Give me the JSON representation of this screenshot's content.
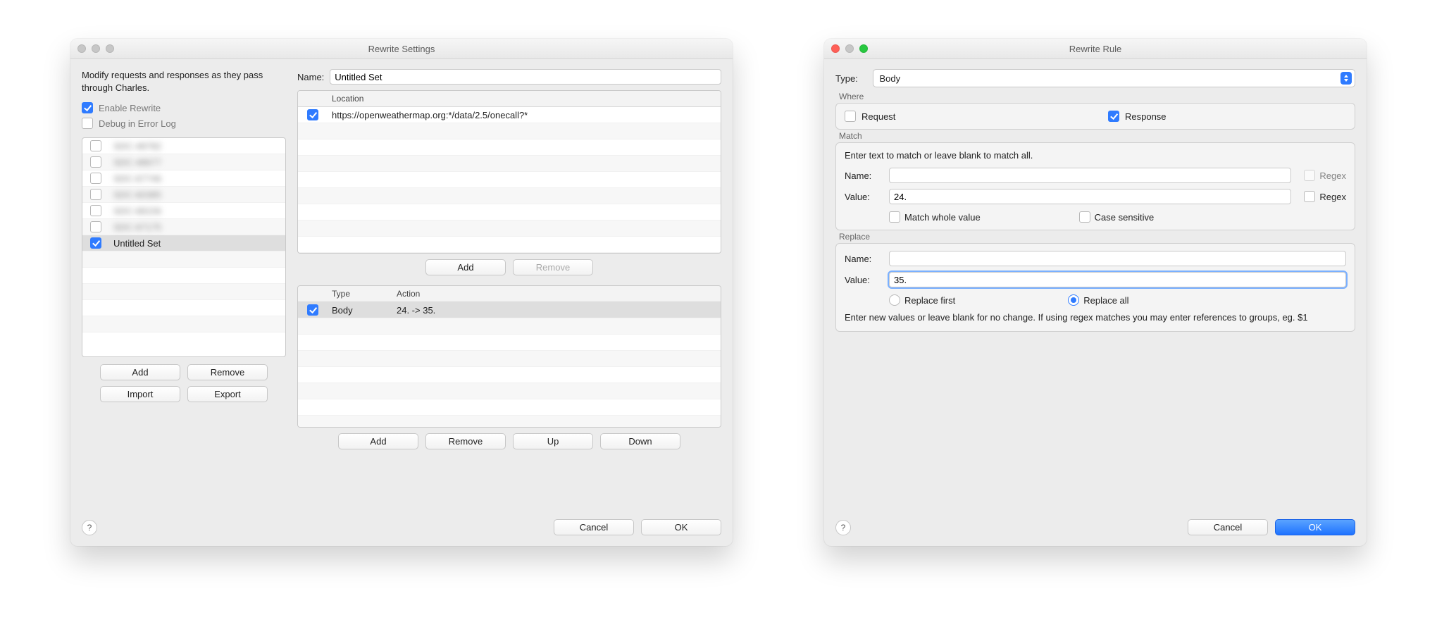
{
  "left": {
    "title": "Rewrite Settings",
    "description": "Modify requests and responses as they pass through Charles.",
    "enable_label": "Enable Rewrite",
    "enable_checked": true,
    "debug_label": "Debug in Error Log",
    "debug_checked": false,
    "sets": {
      "items": [
        {
          "checked": false,
          "label": "SDC-48782",
          "blur": true
        },
        {
          "checked": false,
          "label": "SDC-48677",
          "blur": true
        },
        {
          "checked": false,
          "label": "SDC-67746",
          "blur": true
        },
        {
          "checked": false,
          "label": "SDC-60385",
          "blur": true
        },
        {
          "checked": false,
          "label": "SDC-68156",
          "blur": true
        },
        {
          "checked": false,
          "label": "SDC-67175",
          "blur": true
        },
        {
          "checked": true,
          "label": "Untitled Set",
          "blur": false,
          "selected": true
        }
      ],
      "buttons": {
        "add": "Add",
        "remove": "Remove",
        "import": "Import",
        "export": "Export"
      }
    },
    "name_label": "Name:",
    "name_value": "Untitled Set",
    "locations": {
      "header": "Location",
      "rows": [
        {
          "checked": true,
          "url": "https://openweathermap.org:*/data/2.5/onecall?*"
        }
      ],
      "buttons": {
        "add": "Add",
        "remove": "Remove"
      }
    },
    "rules": {
      "headers": {
        "type": "Type",
        "action": "Action"
      },
      "rows": [
        {
          "checked": true,
          "type": "Body",
          "action": "24. -> 35."
        }
      ],
      "buttons": {
        "add": "Add",
        "remove": "Remove",
        "up": "Up",
        "down": "Down"
      }
    },
    "dialog": {
      "cancel": "Cancel",
      "ok": "OK"
    }
  },
  "right": {
    "title": "Rewrite Rule",
    "type_label": "Type:",
    "type_value": "Body",
    "where": {
      "title": "Where",
      "request_label": "Request",
      "request_checked": false,
      "response_label": "Response",
      "response_checked": true
    },
    "match": {
      "title": "Match",
      "hint": "Enter text to match or leave blank to match all.",
      "name_label": "Name:",
      "name_value": "",
      "name_regex_label": "Regex",
      "name_regex_checked": false,
      "value_label": "Value:",
      "value_value": "24.",
      "value_regex_label": "Regex",
      "value_regex_checked": false,
      "whole_label": "Match whole value",
      "whole_checked": false,
      "case_label": "Case sensitive",
      "case_checked": false
    },
    "replace": {
      "title": "Replace",
      "name_label": "Name:",
      "name_value": "",
      "value_label": "Value:",
      "value_value": "35.",
      "first_label": "Replace first",
      "first_checked": false,
      "all_label": "Replace all",
      "all_checked": true,
      "hint": "Enter new values or leave blank for no change. If using regex matches you may enter references to groups, eg. $1"
    },
    "dialog": {
      "cancel": "Cancel",
      "ok": "OK"
    }
  }
}
